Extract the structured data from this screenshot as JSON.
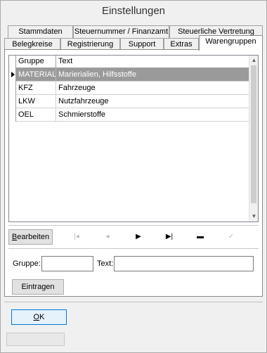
{
  "window": {
    "title": "Einstellungen"
  },
  "tabs_row1": [
    {
      "label": "Stammdaten"
    },
    {
      "label": "Steuernummer / Finanzamt"
    },
    {
      "label": "Steuerliche Vertretung"
    }
  ],
  "tabs_row2": [
    {
      "label": "Belegkreise"
    },
    {
      "label": "Registrierung"
    },
    {
      "label": "Support"
    },
    {
      "label": "Extras"
    },
    {
      "label": "Warengruppen",
      "active": true
    }
  ],
  "grid": {
    "columns": [
      "Gruppe",
      "Text"
    ],
    "rows": [
      {
        "gruppe": "MATERIAL",
        "text": "Marierialien, Hilfsstoffe",
        "selected": true
      },
      {
        "gruppe": "KFZ",
        "text": "Fahrzeuge"
      },
      {
        "gruppe": "LKW",
        "text": "Nutzfahrzeuge"
      },
      {
        "gruppe": "OEL",
        "text": "Schmierstoffe"
      }
    ]
  },
  "toolbar": {
    "edit_label_prefix": "",
    "edit_label_mnemonic": "B",
    "edit_label_rest": "earbeiten",
    "nav": [
      {
        "name": "first",
        "glyph": "|◂",
        "enabled": false
      },
      {
        "name": "prior",
        "glyph": "◂",
        "enabled": false
      },
      {
        "name": "next",
        "glyph": "▶",
        "enabled": true
      },
      {
        "name": "last",
        "glyph": "▶|",
        "enabled": true
      },
      {
        "name": "delete",
        "glyph": "▬",
        "enabled": true
      },
      {
        "name": "post",
        "glyph": "✓",
        "enabled": false
      }
    ]
  },
  "form": {
    "gruppe_label": "Gruppe:",
    "gruppe_value": "",
    "text_label": "Text:",
    "text_value": "",
    "submit_label": "Eintragen"
  },
  "footer": {
    "ok_mnemonic": "O",
    "ok_rest": "K"
  }
}
